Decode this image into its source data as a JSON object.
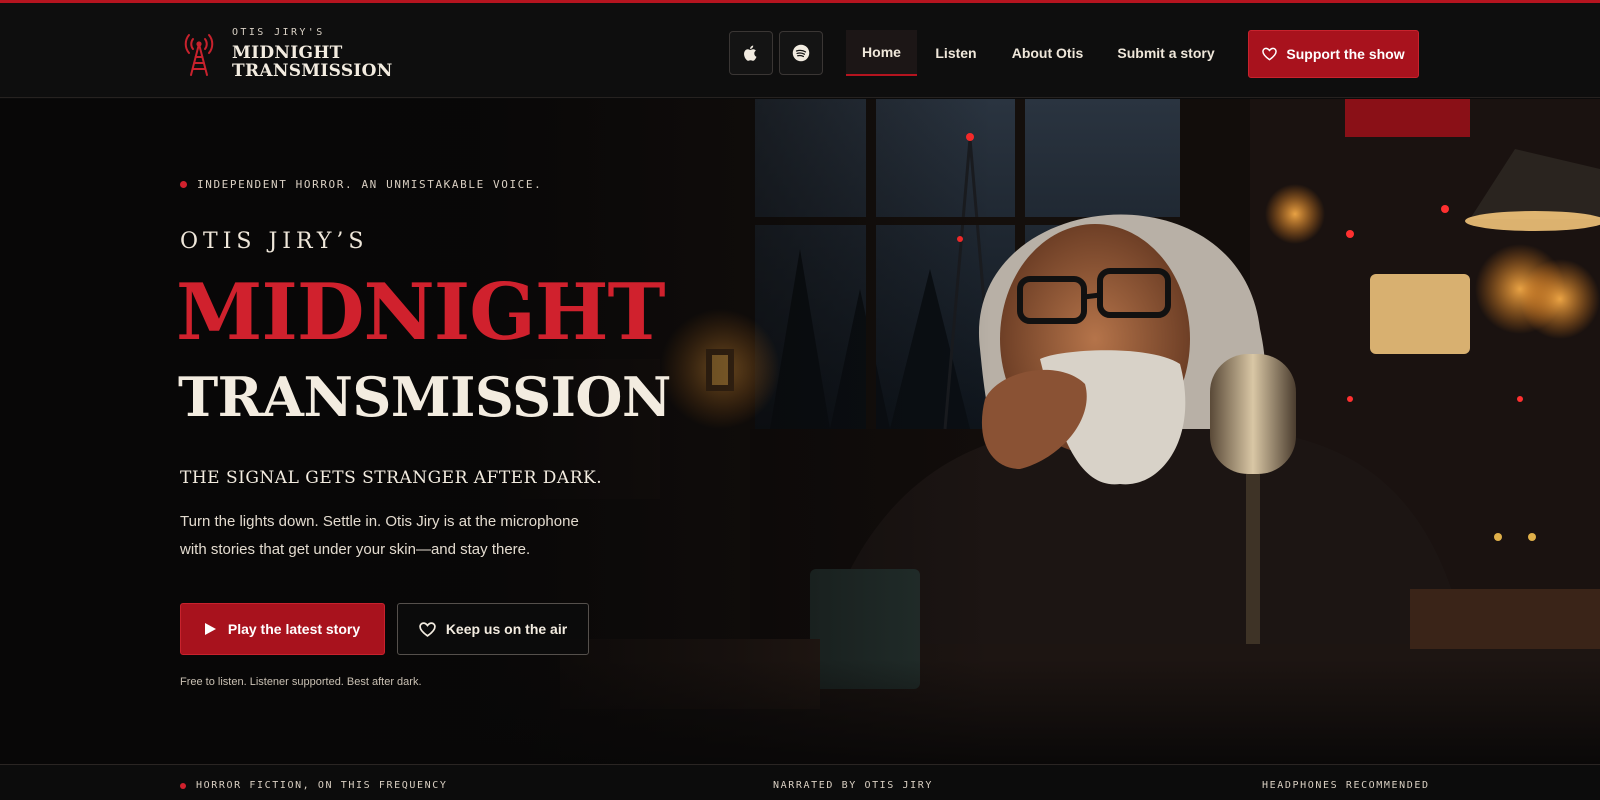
{
  "header": {
    "brand_kicker": "OTIS JIRY'S",
    "brand_line1": "MIDNIGHT",
    "brand_line2": "TRANSMISSION",
    "apple_icon": "apple-icon",
    "spotify_icon": "spotify-icon",
    "nav": [
      {
        "label": "Home",
        "active": true
      },
      {
        "label": "Listen",
        "active": false
      },
      {
        "label": "About Otis",
        "active": false
      },
      {
        "label": "Submit a story",
        "active": false
      }
    ],
    "support_label": "Support the show"
  },
  "hero": {
    "tagline": "INDEPENDENT HORROR. AN UNMISTAKABLE VOICE.",
    "owner": "OTIS JIRY’S",
    "title_line1": "MIDNIGHT",
    "title_line2": "TRANSMISSION",
    "subhead": "THE SIGNAL GETS STRANGER AFTER DARK.",
    "description_line1": "Turn the lights down. Settle in. Otis Jiry is at the microphone",
    "description_line2": "with stories that get under your skin—and stay there.",
    "primary_button": "Play the latest story",
    "secondary_button": "Keep us on the air",
    "fineprint": "Free to listen. Listener supported. Best after dark.",
    "image_subject": "Elderly bearded man with glasses at a vintage microphone in a dim radio studio at night"
  },
  "strip": {
    "left": "HORROR FICTION, ON THIS FREQUENCY",
    "center": "NARRATED BY OTIS JIRY",
    "right": "HEADPHONES RECOMMENDED"
  },
  "colors": {
    "accent": "#d0212d",
    "button_red": "#a8121d",
    "background": "#0b0b0b",
    "text_cream": "#f3ece0"
  }
}
